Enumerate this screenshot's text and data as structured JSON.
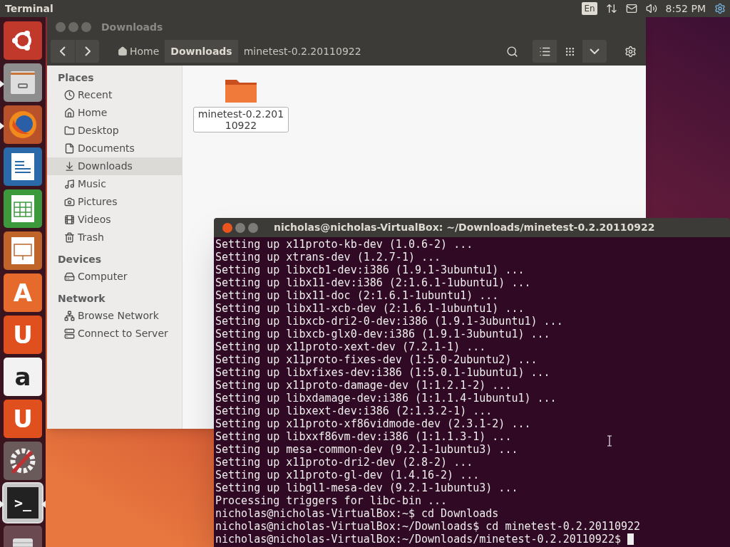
{
  "top_panel": {
    "app_title": "Terminal",
    "keyboard": "En",
    "clock": "8:52 PM"
  },
  "launcher": [
    {
      "kind": "dash",
      "running": false,
      "focused": false
    },
    {
      "kind": "files",
      "running": true,
      "focused": false
    },
    {
      "kind": "firefox",
      "running": true,
      "focused": false
    },
    {
      "kind": "writer",
      "running": false,
      "focused": false
    },
    {
      "kind": "calc",
      "running": false,
      "focused": false
    },
    {
      "kind": "impress",
      "running": false,
      "focused": false
    },
    {
      "kind": "software",
      "glyph": "A",
      "running": false,
      "focused": false
    },
    {
      "kind": "ubuntu-one",
      "glyph": "U",
      "running": false,
      "focused": false
    },
    {
      "kind": "amazon",
      "glyph": "a",
      "running": false,
      "focused": false
    },
    {
      "kind": "music",
      "glyph": "U",
      "running": false,
      "focused": false
    },
    {
      "kind": "settings",
      "running": false,
      "focused": false
    },
    {
      "kind": "terminal",
      "glyph": ">_",
      "running": true,
      "focused": true
    },
    {
      "kind": "disk",
      "running": false,
      "focused": false
    }
  ],
  "file_manager": {
    "title": "Downloads",
    "breadcrumbs": [
      {
        "kind": "home",
        "label": "Home",
        "selected": false
      },
      {
        "kind": "folder",
        "label": "Downloads",
        "selected": true
      },
      {
        "kind": "folder",
        "label": "minetest-0.2.20110922",
        "selected": false
      }
    ],
    "sidebar": [
      {
        "heading": "Places",
        "items": [
          {
            "label": "Recent",
            "selected": false
          },
          {
            "label": "Home",
            "selected": false
          },
          {
            "label": "Desktop",
            "selected": false
          },
          {
            "label": "Documents",
            "selected": false
          },
          {
            "label": "Downloads",
            "selected": true
          },
          {
            "label": "Music",
            "selected": false
          },
          {
            "label": "Pictures",
            "selected": false
          },
          {
            "label": "Videos",
            "selected": false
          },
          {
            "label": "Trash",
            "selected": false
          }
        ]
      },
      {
        "heading": "Devices",
        "items": [
          {
            "label": "Computer",
            "selected": false
          }
        ]
      },
      {
        "heading": "Network",
        "items": [
          {
            "label": "Browse Network",
            "selected": false
          },
          {
            "label": "Connect to Server",
            "selected": false
          }
        ]
      }
    ],
    "files": [
      {
        "kind": "folder",
        "name": "minetest-0.2.20110922",
        "selected": true
      }
    ]
  },
  "terminal": {
    "title": "nicholas@nicholas-VirtualBox: ~/Downloads/minetest-0.2.20110922",
    "lines": [
      "Setting up x11proto-kb-dev (1.0.6-2) ...",
      "Setting up xtrans-dev (1.2.7-1) ...",
      "Setting up libxcb1-dev:i386 (1.9.1-3ubuntu1) ...",
      "Setting up libx11-dev:i386 (2:1.6.1-1ubuntu1) ...",
      "Setting up libx11-doc (2:1.6.1-1ubuntu1) ...",
      "Setting up libx11-xcb-dev (2:1.6.1-1ubuntu1) ...",
      "Setting up libxcb-dri2-0-dev:i386 (1.9.1-3ubuntu1) ...",
      "Setting up libxcb-glx0-dev:i386 (1.9.1-3ubuntu1) ...",
      "Setting up x11proto-xext-dev (7.2.1-1) ...",
      "Setting up x11proto-fixes-dev (1:5.0-2ubuntu2) ...",
      "Setting up libxfixes-dev:i386 (1:5.0.1-1ubuntu1) ...",
      "Setting up x11proto-damage-dev (1:1.2.1-2) ...",
      "Setting up libxdamage-dev:i386 (1:1.1.4-1ubuntu1) ...",
      "Setting up libxext-dev:i386 (2:1.3.2-1) ...",
      "Setting up x11proto-xf86vidmode-dev (2.3.1-2) ...",
      "Setting up libxxf86vm-dev:i386 (1:1.1.3-1) ...",
      "Setting up mesa-common-dev (9.2.1-1ubuntu3) ...",
      "Setting up x11proto-dri2-dev (2.8-2) ...",
      "Setting up x11proto-gl-dev (1.4.16-2) ...",
      "Setting up libgl1-mesa-dev (9.2.1-1ubuntu3) ...",
      "Processing triggers for libc-bin ...",
      "nicholas@nicholas-VirtualBox:~$ cd Downloads",
      "nicholas@nicholas-VirtualBox:~/Downloads$ cd minetest-0.2.20110922",
      "nicholas@nicholas-VirtualBox:~/Downloads/minetest-0.2.20110922$ "
    ]
  }
}
